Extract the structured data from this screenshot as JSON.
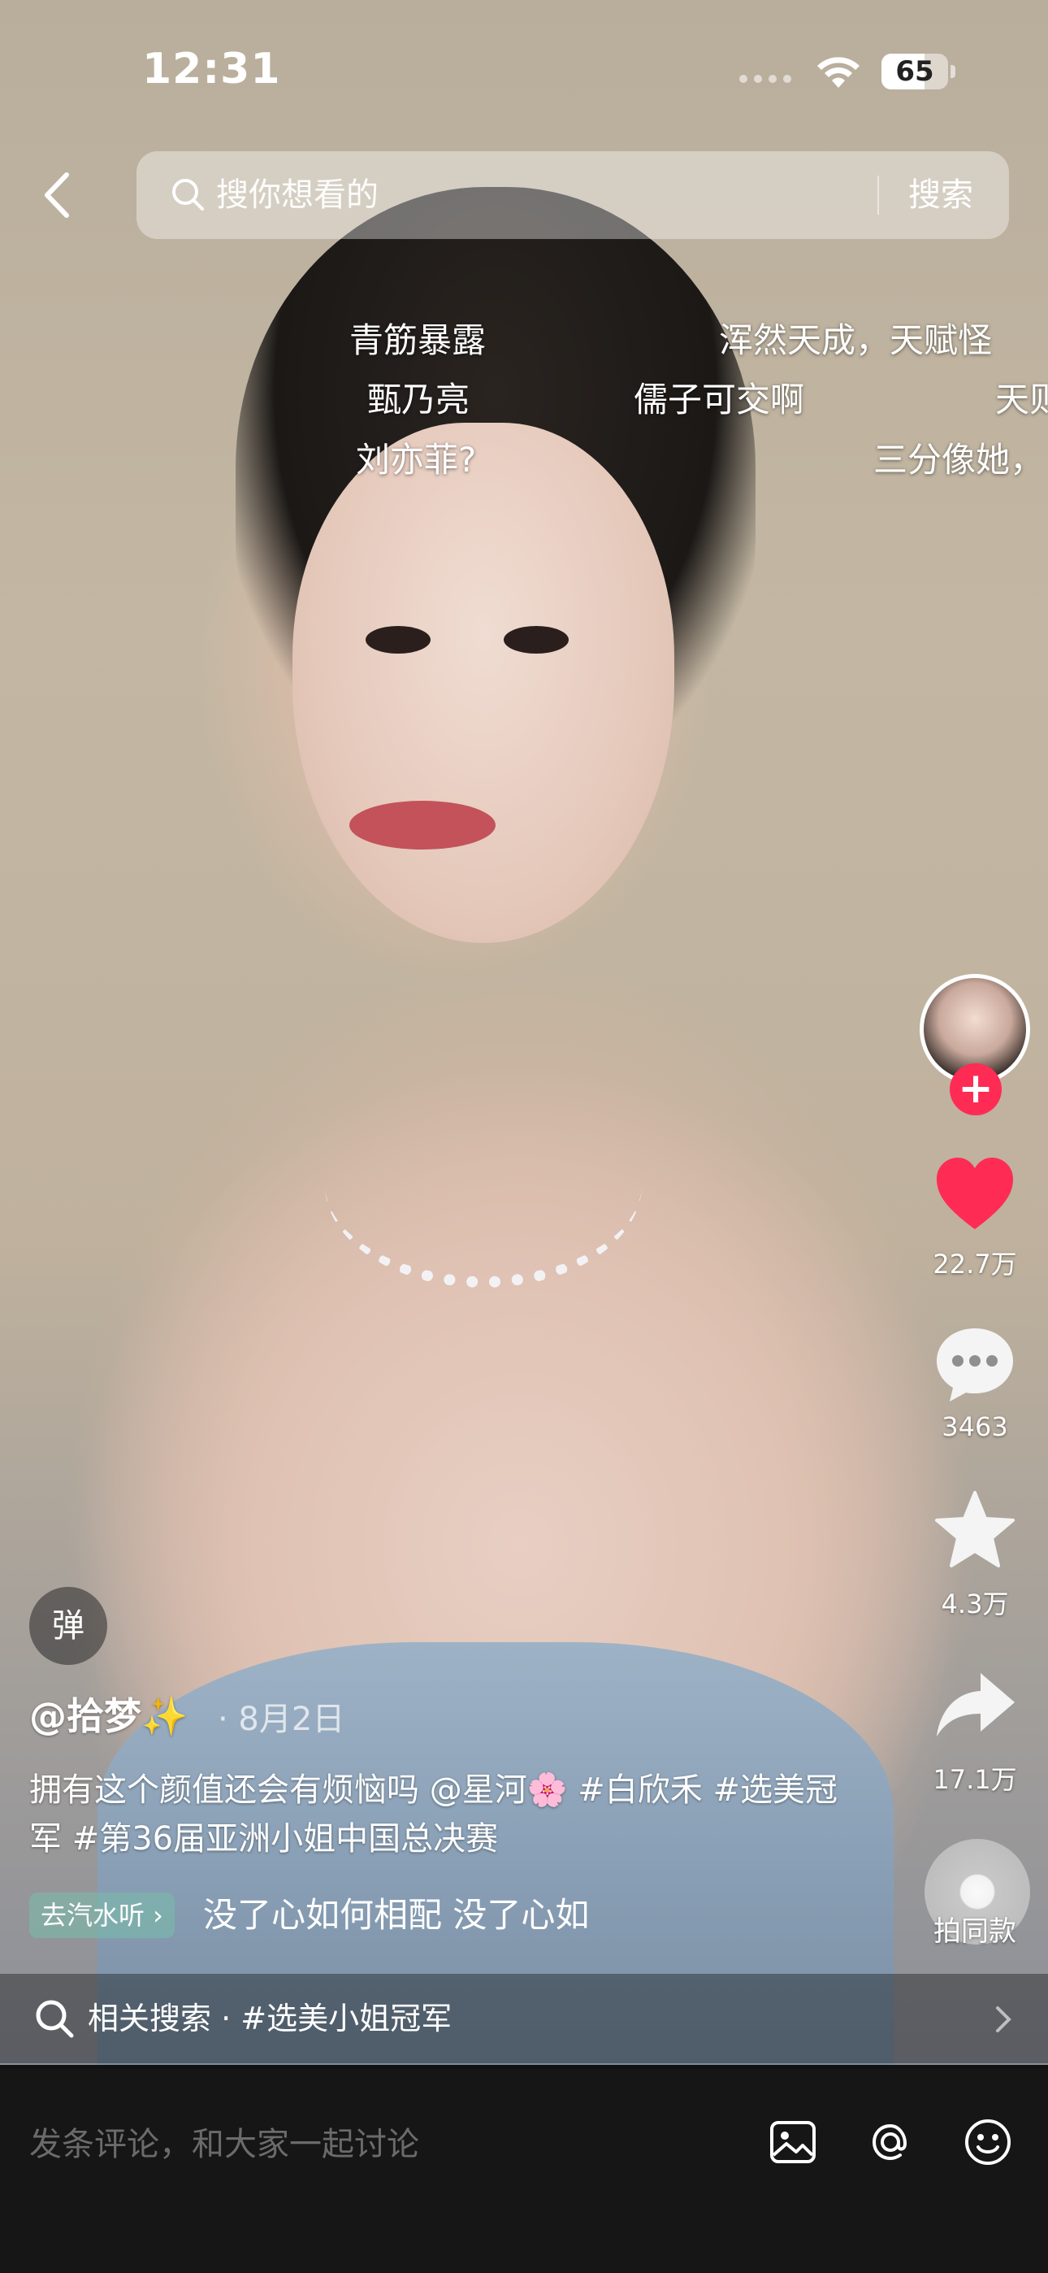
{
  "status_bar": {
    "time": "12:31",
    "battery": "65",
    "battery_level": 0.65
  },
  "search": {
    "placeholder": "搜你想看的",
    "button": "搜索"
  },
  "danmaku": [
    "青筋暴露",
    "浑然天成，天赋怪",
    "甄乃亮",
    "儒子可交啊",
    "天则",
    "刘亦菲?",
    "三分像她，"
  ],
  "rail": {
    "likes": "22.7万",
    "comments": "3463",
    "favorites": "4.3万",
    "shares": "17.1万",
    "same_style": "拍同款"
  },
  "post": {
    "danmaku_toggle": "弹",
    "author": "@拾梦✨",
    "date": "· 8月2日",
    "caption": "拥有这个颜值还会有烦恼吗 @星河🌸 #白欣禾 #选美冠军 #第36届亚洲小姐中国总决赛",
    "music_tag": "去汽水听 ›",
    "music_text": "没了心如何相配  没了心如"
  },
  "related": {
    "label": "相关搜索 · #选美小姐冠军"
  },
  "comment_bar": {
    "placeholder": "发条评论，和大家一起讨论"
  },
  "colors": {
    "accent": "#fe2c55",
    "like": "#fe2c55",
    "music_tag_bg": "#78beaa"
  }
}
